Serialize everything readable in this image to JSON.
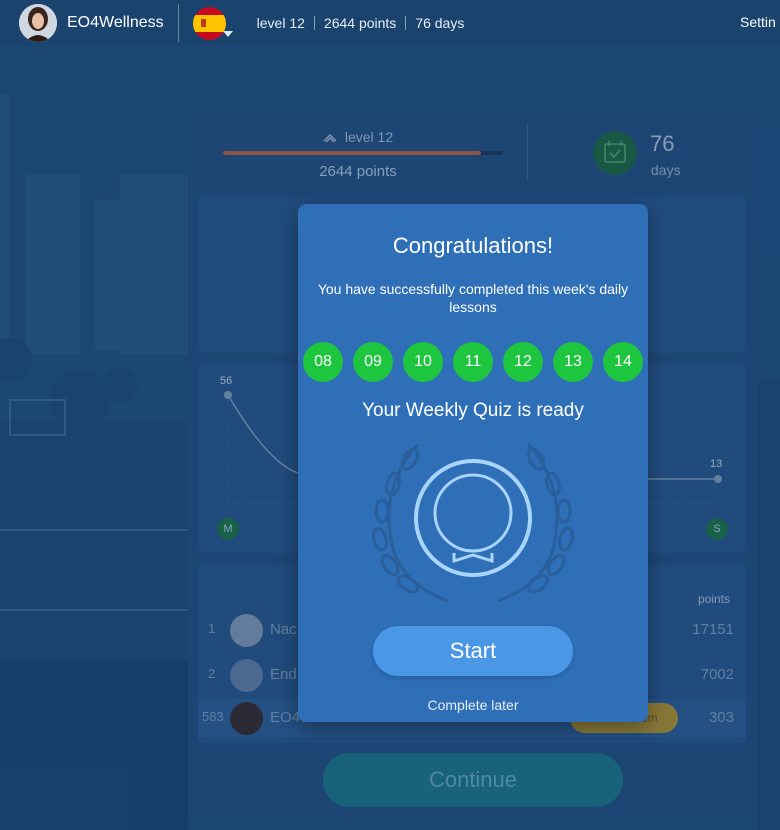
{
  "header": {
    "username": "EO4Wellness",
    "flag_icon": "spain-flag-icon",
    "level": "level 12",
    "points": "2644 points",
    "days": "76 days",
    "settings": "Settin"
  },
  "summary": {
    "level_label": "level 12",
    "level_progress": 0.92,
    "points_label": "2644 points",
    "days_count": "76",
    "days_label": "days"
  },
  "chart": {
    "start_value": "56",
    "end_value": "13",
    "start_day": "M",
    "end_day": "S"
  },
  "leaderboard": {
    "points_header": "points",
    "rows": [
      {
        "rank": "1",
        "name": "Nac",
        "points": "17151"
      },
      {
        "rank": "2",
        "name": "End",
        "points": "7002"
      },
      {
        "rank": "583",
        "name": "EO4Wellness",
        "points": "303",
        "badge": "Go Premium"
      }
    ]
  },
  "continue_label": "Continue",
  "modal": {
    "title": "Congratulations!",
    "subtitle": "You have successfully completed this week's daily lessons",
    "days": [
      "08",
      "09",
      "10",
      "11",
      "12",
      "13",
      "14"
    ],
    "quiz_ready": "Your Weekly Quiz is ready",
    "start_label": "Start",
    "later_label": "Complete later"
  },
  "colors": {
    "modal_bg": "#2e6fb8",
    "day_complete": "#1ec53f",
    "start_button": "#4a97e6"
  }
}
